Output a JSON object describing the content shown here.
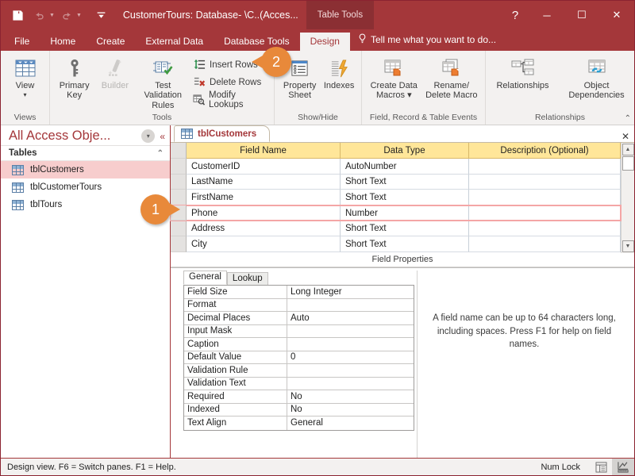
{
  "titlebar": {
    "quick_access": [
      {
        "name": "save-icon",
        "label": "Save"
      },
      {
        "name": "undo-icon",
        "label": "Undo"
      },
      {
        "name": "redo-icon",
        "label": "Redo"
      },
      {
        "name": "customize-quick-access-icon",
        "label": "Customize Quick Access Toolbar"
      }
    ],
    "title": "CustomerTours: Database- \\C..(Acces...",
    "contextual_tab": "Table Tools",
    "help_label": "?",
    "minimize_label": "─",
    "restore_label": "☐",
    "close_label": "✕"
  },
  "ribbon": {
    "tabs": [
      {
        "label": "File",
        "active": false
      },
      {
        "label": "Home",
        "active": false
      },
      {
        "label": "Create",
        "active": false
      },
      {
        "label": "External Data",
        "active": false
      },
      {
        "label": "Database Tools",
        "active": false
      },
      {
        "label": "Design",
        "active": true
      }
    ],
    "tell_me": "Tell me what you want to do...",
    "groups": [
      {
        "label": "Views",
        "big_buttons": [
          {
            "name": "view-button",
            "line1": "View",
            "line2": "▾",
            "disabled": false
          }
        ],
        "small_buttons": []
      },
      {
        "label": "Tools",
        "big_buttons": [
          {
            "name": "primary-key-button",
            "line1": "Primary",
            "line2": "Key",
            "disabled": false
          },
          {
            "name": "builder-button",
            "line1": "Builder",
            "line2": "",
            "disabled": true
          },
          {
            "name": "test-validation-rules-button",
            "line1": "Test Validation",
            "line2": "Rules",
            "disabled": false
          }
        ],
        "small_buttons": [
          {
            "name": "insert-rows-button",
            "label": "Insert Rows"
          },
          {
            "name": "delete-rows-button",
            "label": "Delete Rows"
          },
          {
            "name": "modify-lookups-button",
            "label": "Modify Lookups"
          }
        ]
      },
      {
        "label": "Show/Hide",
        "big_buttons": [
          {
            "name": "property-sheet-button",
            "line1": "Property",
            "line2": "Sheet",
            "disabled": false
          },
          {
            "name": "indexes-button",
            "line1": "Indexes",
            "line2": "",
            "disabled": false
          }
        ],
        "small_buttons": []
      },
      {
        "label": "Field, Record & Table Events",
        "big_buttons": [
          {
            "name": "create-data-macros-button",
            "line1": "Create Data",
            "line2": "Macros ▾",
            "disabled": false
          },
          {
            "name": "rename-delete-macro-button",
            "line1": "Rename/",
            "line2": "Delete Macro",
            "disabled": false
          }
        ],
        "small_buttons": []
      },
      {
        "label": "Relationships",
        "big_buttons": [
          {
            "name": "relationships-button",
            "line1": "Relationships",
            "line2": "",
            "disabled": false
          },
          {
            "name": "object-dependencies-button",
            "line1": "Object",
            "line2": "Dependencies",
            "disabled": false
          }
        ],
        "small_buttons": []
      }
    ],
    "collapse_label": "⌃"
  },
  "navpane": {
    "title": "All Access Obje...",
    "dropdown_label": "▾",
    "collapse_label": "«",
    "group_label": "Tables",
    "group_chevron": "⌃",
    "items": [
      {
        "label": "tblCustomers",
        "selected": true
      },
      {
        "label": "tblCustomerTours",
        "selected": false
      },
      {
        "label": "tblTours",
        "selected": false
      }
    ]
  },
  "document": {
    "tab_label": "tblCustomers",
    "close_label": "✕",
    "grid": {
      "columns": [
        "Field Name",
        "Data Type",
        "Description (Optional)"
      ],
      "rows": [
        {
          "field_name": "CustomerID",
          "data_type": "AutoNumber",
          "description": "",
          "current": false
        },
        {
          "field_name": "LastName",
          "data_type": "Short Text",
          "description": "",
          "current": false
        },
        {
          "field_name": "FirstName",
          "data_type": "Short Text",
          "description": "",
          "current": false
        },
        {
          "field_name": "Phone",
          "data_type": "Number",
          "description": "",
          "current": true
        },
        {
          "field_name": "Address",
          "data_type": "Short Text",
          "description": "",
          "current": false
        },
        {
          "field_name": "City",
          "data_type": "Short Text",
          "description": "",
          "current": false
        }
      ],
      "scroll_up_label": "▲",
      "scroll_down_label": "▼"
    },
    "field_properties_label": "Field Properties",
    "property_tabs": [
      {
        "label": "General",
        "active": true
      },
      {
        "label": "Lookup",
        "active": false
      }
    ],
    "properties": [
      {
        "name": "Field Size",
        "value": "Long Integer"
      },
      {
        "name": "Format",
        "value": ""
      },
      {
        "name": "Decimal Places",
        "value": "Auto"
      },
      {
        "name": "Input Mask",
        "value": ""
      },
      {
        "name": "Caption",
        "value": ""
      },
      {
        "name": "Default Value",
        "value": "0"
      },
      {
        "name": "Validation Rule",
        "value": ""
      },
      {
        "name": "Validation Text",
        "value": ""
      },
      {
        "name": "Required",
        "value": "No"
      },
      {
        "name": "Indexed",
        "value": "No"
      },
      {
        "name": "Text Align",
        "value": "General"
      }
    ],
    "help_text": "A field name can be up to 64 characters long, including spaces. Press F1 for help on field names."
  },
  "statusbar": {
    "message": "Design view.  F6 = Switch panes.  F1 = Help.",
    "num_lock": "Num Lock",
    "views": [
      {
        "name": "datasheet-view-icon",
        "active": false
      },
      {
        "name": "design-view-icon",
        "active": true
      }
    ]
  },
  "callouts": [
    {
      "number": "1",
      "direction": "point-right"
    },
    {
      "number": "2",
      "direction": "point-left"
    }
  ],
  "colors": {
    "accent": "#a4373a",
    "accent_dark": "#8b2f33",
    "callout": "#e8893a",
    "header_yellow": "#ffe699",
    "selection_pink": "#f7cdcd"
  }
}
